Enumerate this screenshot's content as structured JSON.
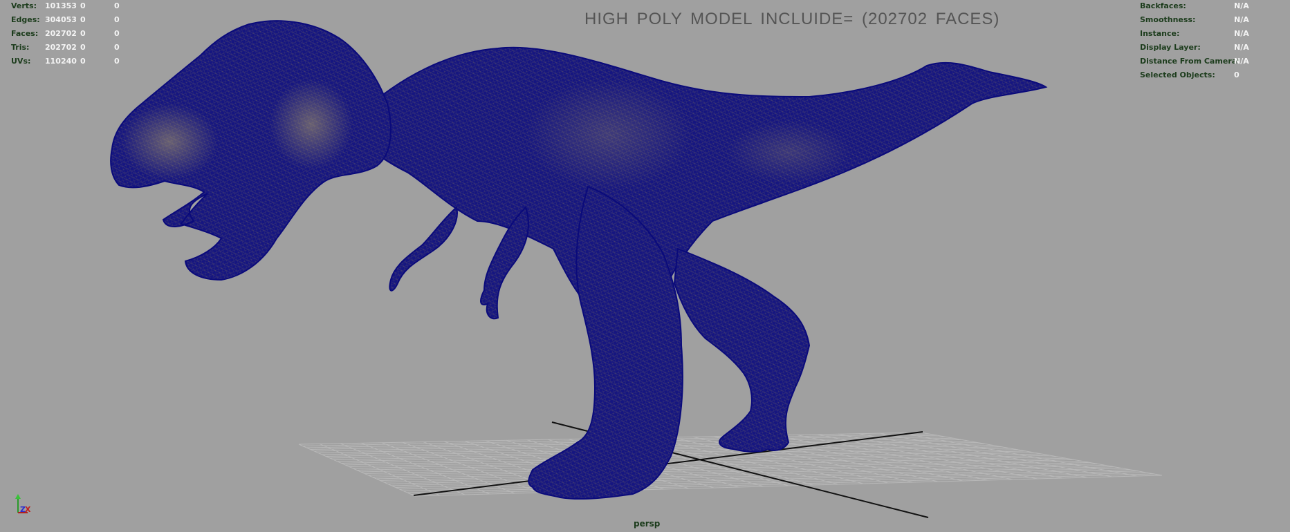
{
  "title": "HIGH POLY MODEL INCLUIDE= (202702 FACES)",
  "camera": "persp",
  "colors": {
    "background": "#a0a0a0",
    "wireframe": "#0a0a7a",
    "mesh_fill": "#6a6a6a",
    "hud_label": "#1c3c1c",
    "hud_value": "#f4f4f4"
  },
  "poly_count": [
    {
      "label": "Verts:",
      "v1": "101353",
      "v2": "0",
      "v3": "0"
    },
    {
      "label": "Edges:",
      "v1": "304053",
      "v2": "0",
      "v3": "0"
    },
    {
      "label": "Faces:",
      "v1": "202702",
      "v2": "0",
      "v3": "0"
    },
    {
      "label": "Tris:",
      "v1": "202702",
      "v2": "0",
      "v3": "0"
    },
    {
      "label": "UVs:",
      "v1": "110240",
      "v2": "0",
      "v3": "0"
    }
  ],
  "object_details": [
    {
      "label": "Backfaces:",
      "value": "N/A"
    },
    {
      "label": "Smoothness:",
      "value": "N/A"
    },
    {
      "label": "Instance:",
      "value": "N/A"
    },
    {
      "label": "Display Layer:",
      "value": "N/A"
    },
    {
      "label": "Distance From Camera:",
      "value": "N/A"
    },
    {
      "label": "Selected Objects:",
      "value": "0"
    }
  ],
  "axis": {
    "x": "X",
    "y": "Y",
    "z": "Z"
  }
}
